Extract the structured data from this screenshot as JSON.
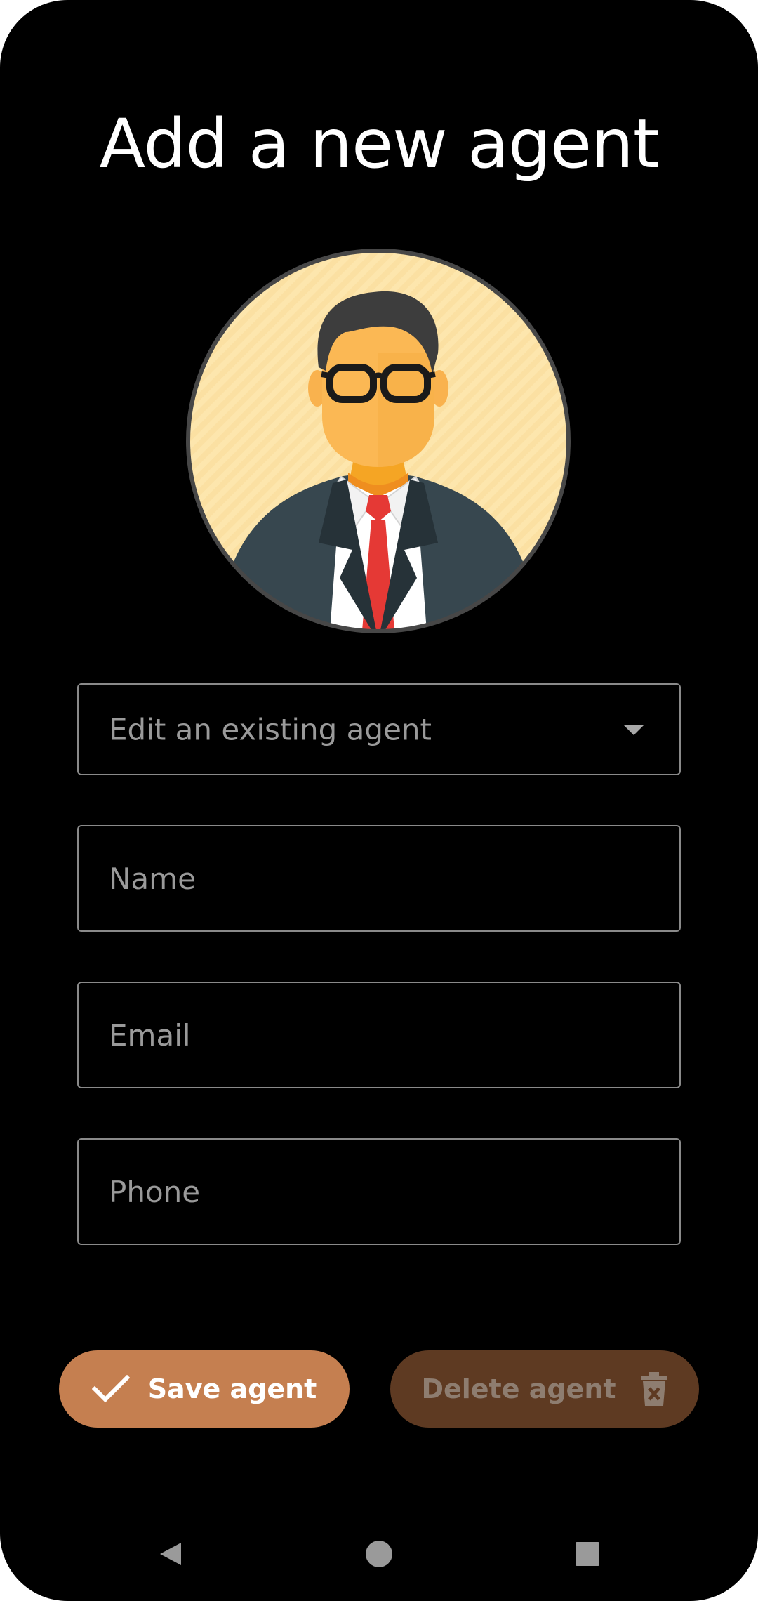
{
  "page": {
    "title": "Add a new agent"
  },
  "avatar": {
    "icon": "businessman-avatar-icon"
  },
  "form": {
    "agent_select": {
      "placeholder": "Edit an existing agent",
      "icon": "dropdown-arrow-icon"
    },
    "name": {
      "placeholder": "Name",
      "value": ""
    },
    "email": {
      "placeholder": "Email",
      "value": ""
    },
    "phone": {
      "placeholder": "Phone",
      "value": ""
    }
  },
  "actions": {
    "save_label": "Save agent",
    "save_icon": "check-icon",
    "delete_label": "Delete agent",
    "delete_icon": "trash-icon",
    "save_color": "#c57f50",
    "delete_color": "#5e3a22"
  },
  "navigation_bar": {
    "back_icon": "nav-back-icon",
    "home_icon": "nav-home-icon",
    "recents_icon": "nav-recents-icon"
  }
}
